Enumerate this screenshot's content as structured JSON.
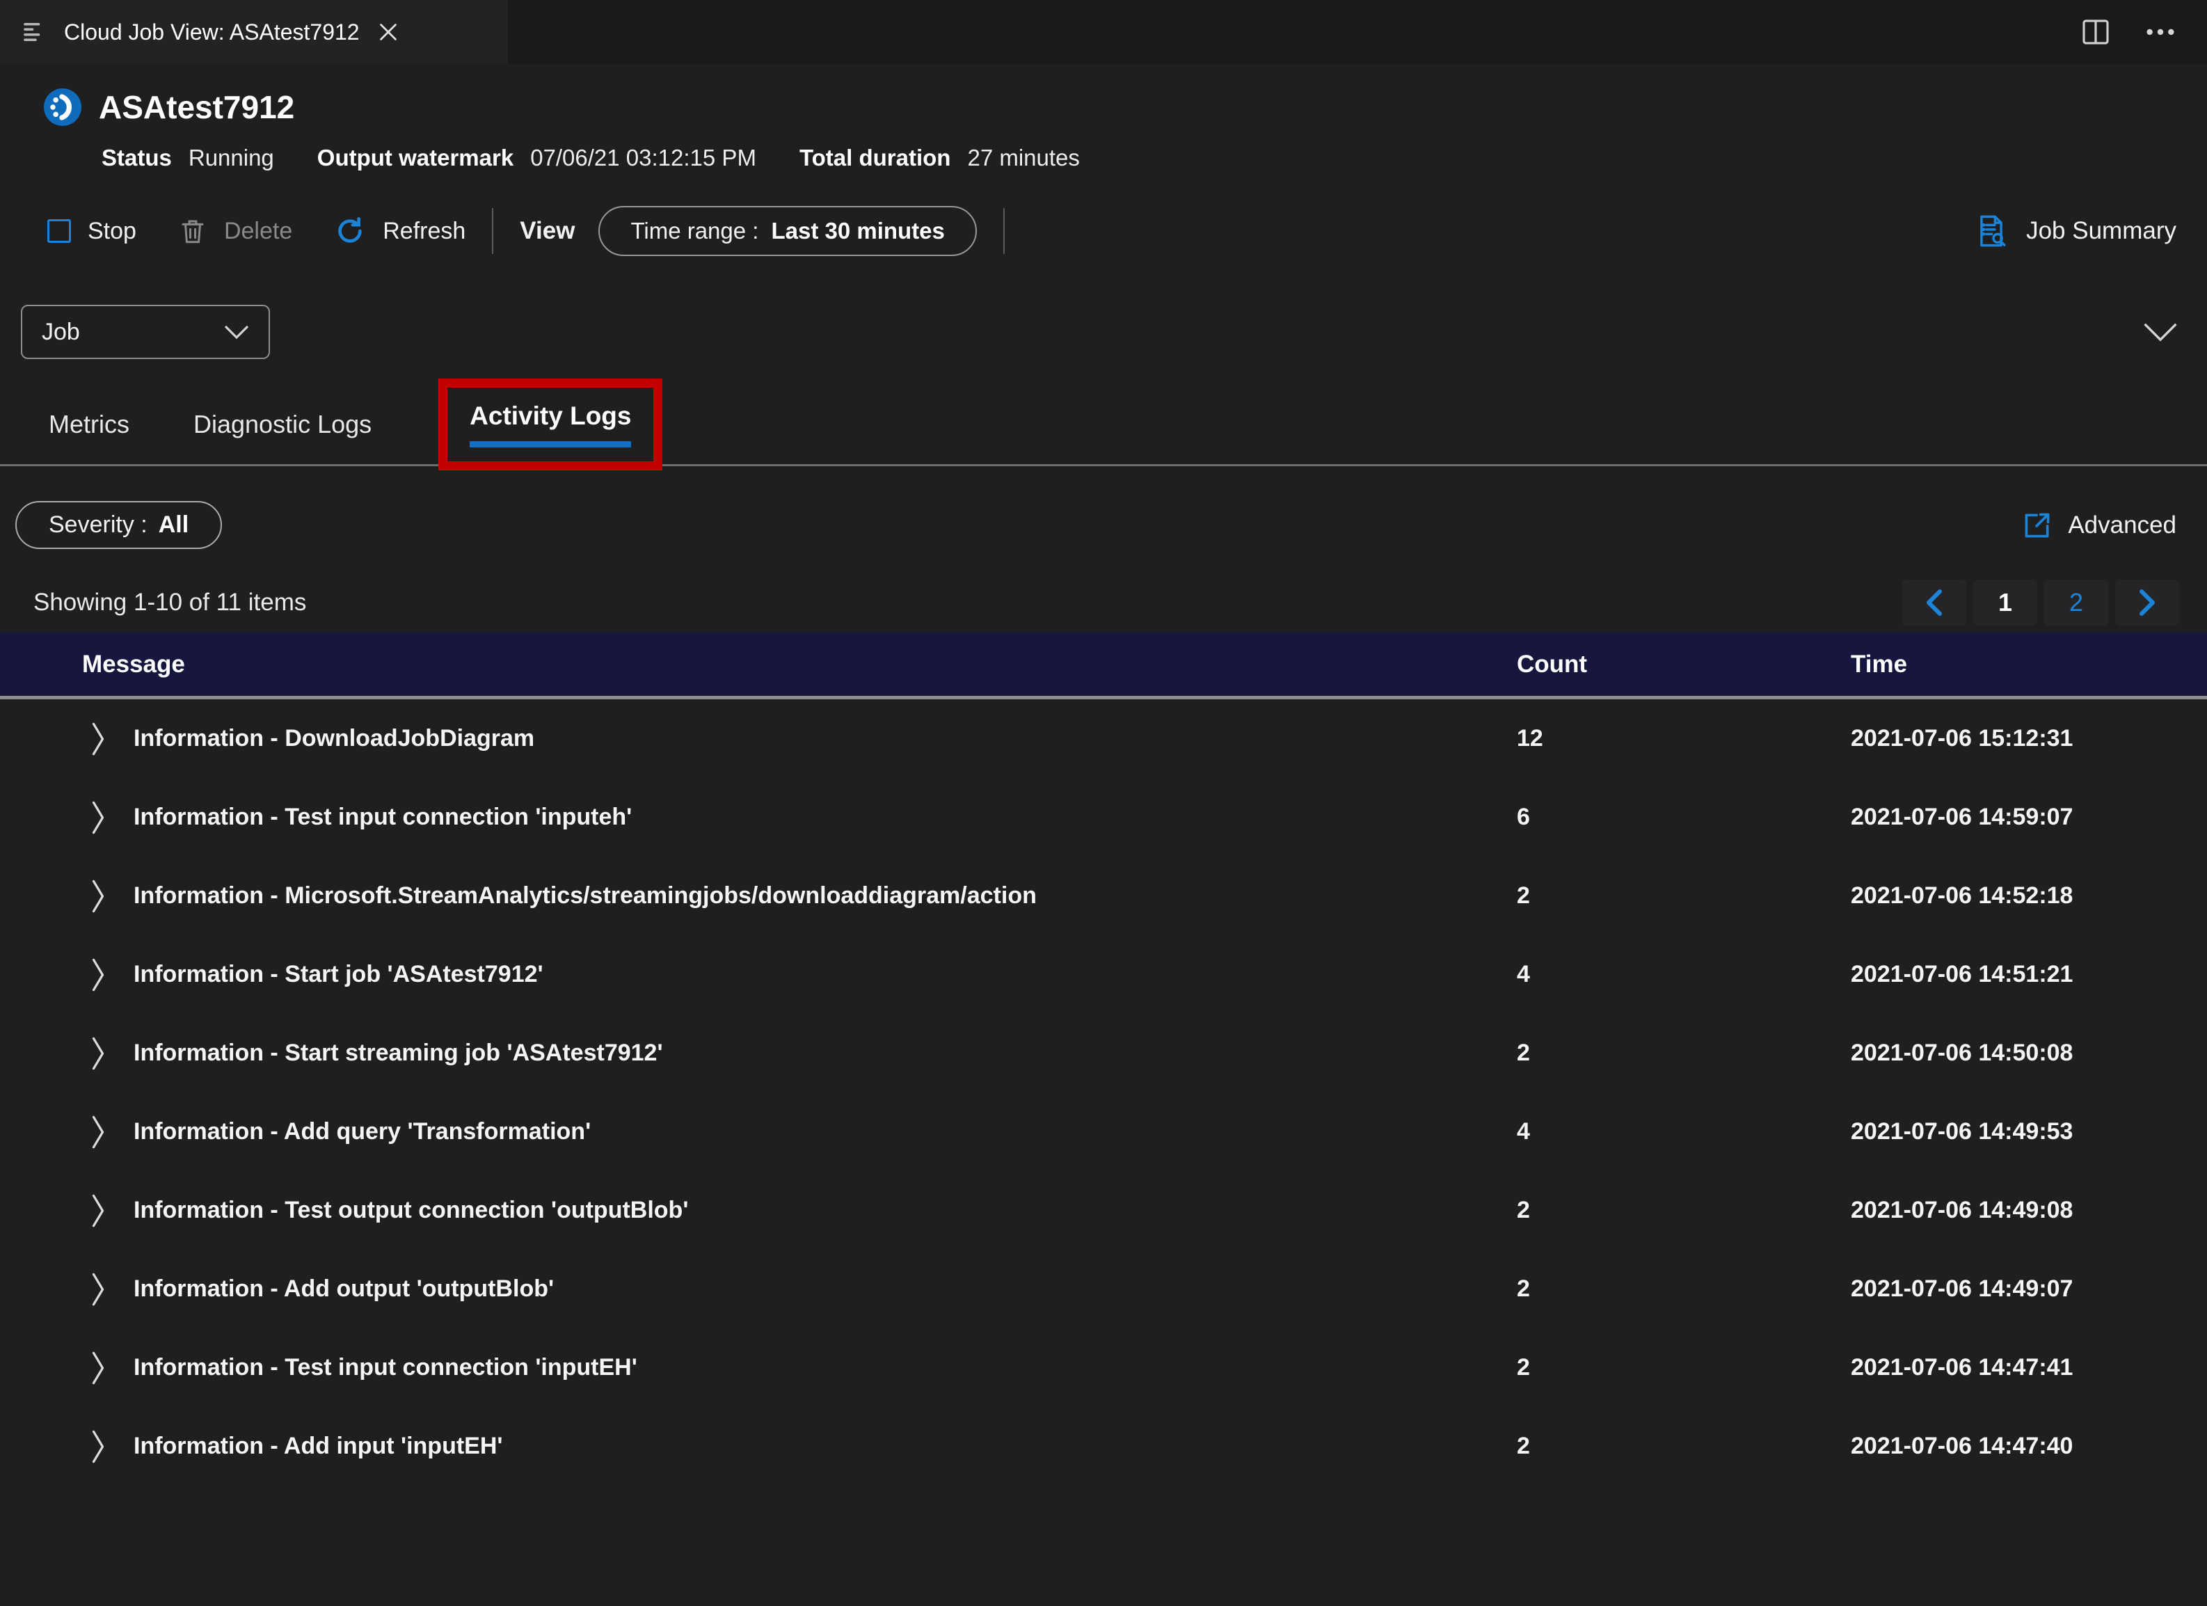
{
  "editor": {
    "tab_title": "Cloud Job View: ASAtest7912"
  },
  "header": {
    "title": "ASAtest7912",
    "status_label": "Status",
    "status_value": "Running",
    "watermark_label": "Output watermark",
    "watermark_value": "07/06/21 03:12:15 PM",
    "duration_label": "Total duration",
    "duration_value": "27 minutes"
  },
  "toolbar": {
    "stop_label": "Stop",
    "delete_label": "Delete",
    "refresh_label": "Refresh",
    "view_label": "View",
    "time_range_label": "Time range :",
    "time_range_value": "Last 30 minutes",
    "job_summary_label": "Job Summary"
  },
  "job_selector": {
    "value": "Job"
  },
  "tabs": [
    {
      "label": "Metrics"
    },
    {
      "label": "Diagnostic Logs"
    },
    {
      "label": "Activity Logs"
    }
  ],
  "filters": {
    "severity_label": "Severity :",
    "severity_value": "All",
    "advanced_label": "Advanced"
  },
  "list": {
    "summary": "Showing 1-10 of 11 items",
    "pages": [
      "1",
      "2"
    ]
  },
  "table": {
    "columns": [
      "Message",
      "Count",
      "Time"
    ],
    "rows": [
      {
        "message": "Information - DownloadJobDiagram",
        "count": "12",
        "time": "2021-07-06 15:12:31"
      },
      {
        "message": "Information - Test input connection 'inputeh'",
        "count": "6",
        "time": "2021-07-06 14:59:07"
      },
      {
        "message": "Information - Microsoft.StreamAnalytics/streamingjobs/downloaddiagram/action",
        "count": "2",
        "time": "2021-07-06 14:52:18"
      },
      {
        "message": "Information - Start job 'ASAtest7912'",
        "count": "4",
        "time": "2021-07-06 14:51:21"
      },
      {
        "message": "Information - Start streaming job 'ASAtest7912'",
        "count": "2",
        "time": "2021-07-06 14:50:08"
      },
      {
        "message": "Information - Add query 'Transformation'",
        "count": "4",
        "time": "2021-07-06 14:49:53"
      },
      {
        "message": "Information - Test output connection 'outputBlob'",
        "count": "2",
        "time": "2021-07-06 14:49:08"
      },
      {
        "message": "Information - Add output 'outputBlob'",
        "count": "2",
        "time": "2021-07-06 14:49:07"
      },
      {
        "message": "Information - Test input connection 'inputEH'",
        "count": "2",
        "time": "2021-07-06 14:47:41"
      },
      {
        "message": "Information - Add input 'inputEH'",
        "count": "2",
        "time": "2021-07-06 14:47:40"
      }
    ]
  },
  "colors": {
    "accent_blue": "#1b84d8",
    "table_header_bg": "#16163e",
    "annotation_red": "#c40000"
  }
}
